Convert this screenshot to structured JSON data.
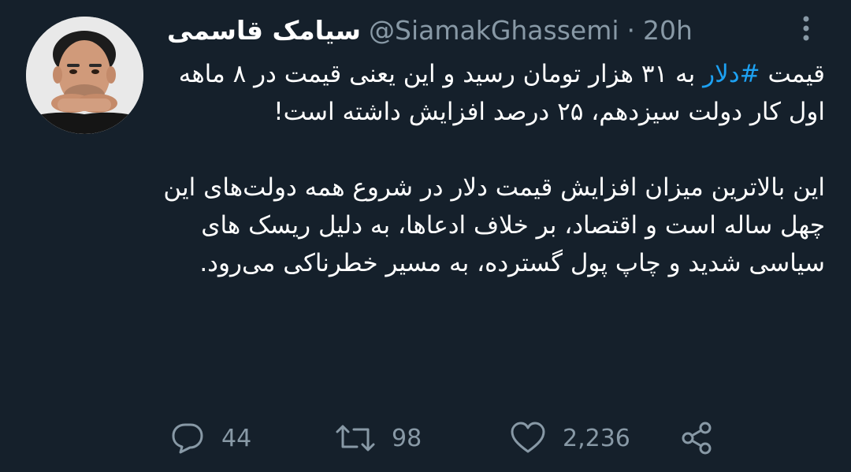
{
  "tweet": {
    "author": {
      "display_name": "سیامک قاسمی",
      "handle": "@SiamakGhassemi",
      "separator": "·",
      "time": "20h"
    },
    "paragraph1": {
      "before_hashtag": "قیمت ",
      "hashtag": "#دلار",
      "after_hashtag": " به ۳۱ هزار تومان رسید و این یعنی قیمت در ۸ ماهه اول کار دولت سیزدهم، ۲۵ درصد افزایش داشته است!"
    },
    "paragraph2": "این بالاترین میزان افزایش قیمت دلار در شروع همه دولت‌های این چهل ساله است و اقتصاد، بر خلاف ادعاها، به دلیل ریسک های سیاسی شدید و چاپ پول گسترده، به مسیر خطرناکی می‌رود.",
    "actions": {
      "reply_icon": "reply-icon",
      "reply_count": "44",
      "retweet_icon": "retweet-icon",
      "retweet_count": "98",
      "like_icon": "heart-icon",
      "like_count": "2,236",
      "share_icon": "share-icon"
    }
  },
  "colors": {
    "background": "#15202b",
    "primary_text": "#ffffff",
    "secondary_text": "#8899a6",
    "hashtag": "#1da1f2"
  }
}
